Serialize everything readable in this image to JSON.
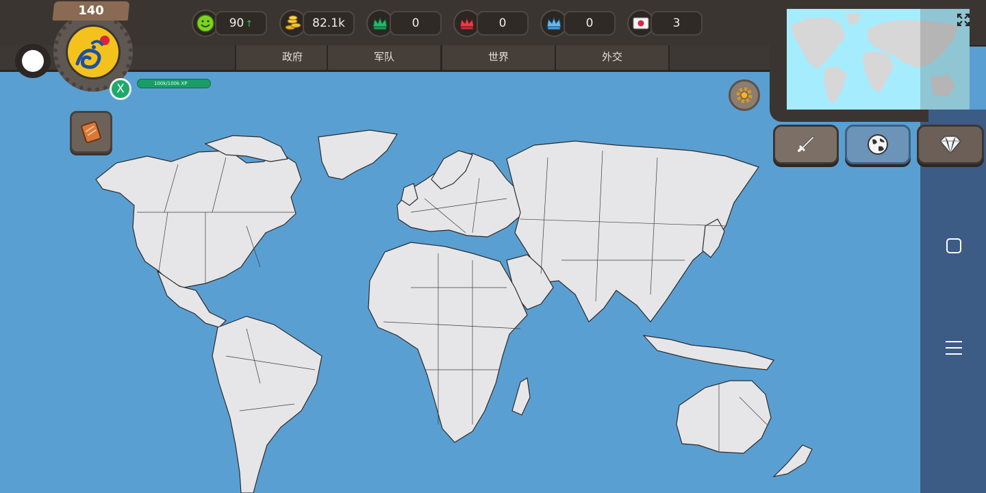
{
  "profile": {
    "level": "140",
    "close_label": "X",
    "xp_text": "100k/100k XP"
  },
  "resources": [
    {
      "icon": "happiness-icon",
      "value": "90",
      "trend": "↑"
    },
    {
      "icon": "gold-coins-icon",
      "value": "82.1k"
    },
    {
      "icon": "green-crown-icon",
      "value": "0"
    },
    {
      "icon": "red-crown-icon",
      "value": "0"
    },
    {
      "icon": "blue-crown-icon",
      "value": "0"
    },
    {
      "icon": "japan-flag-icon",
      "value": "3"
    }
  ],
  "tabs": [
    {
      "label": "政府"
    },
    {
      "label": "军队"
    },
    {
      "label": "世界"
    },
    {
      "label": "外交"
    }
  ],
  "colors": {
    "ocean": "#5a9fd2",
    "land": "#e6e6e8",
    "top_bar": "#3b3531",
    "xp_bar": "#1a9c66",
    "nav_bar": "#3c5b85",
    "minimap_ocean": "#a6ecff"
  },
  "actions": {
    "war": "sword-icon",
    "globe": "globe-icon",
    "shop": "diamond-icon"
  }
}
